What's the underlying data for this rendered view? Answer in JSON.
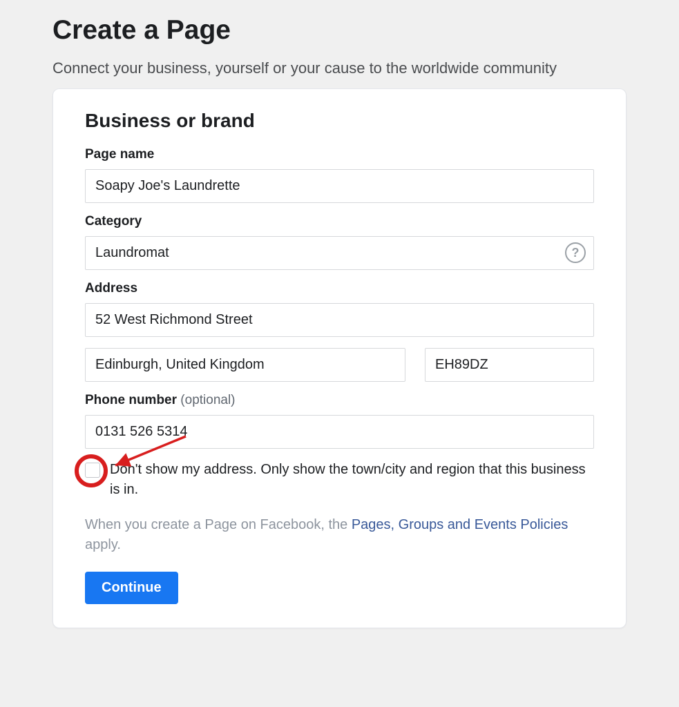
{
  "header": {
    "title": "Create a Page",
    "subtitle": "Connect your business, yourself or your cause to the worldwide community"
  },
  "form": {
    "section_title": "Business or brand",
    "page_name": {
      "label": "Page name",
      "value": "Soapy Joe's Laundrette"
    },
    "category": {
      "label": "Category",
      "value": "Laundromat"
    },
    "address": {
      "label": "Address",
      "street": "52 West Richmond Street",
      "city": "Edinburgh, United Kingdom",
      "postcode": "EH89DZ"
    },
    "phone": {
      "label": "Phone number",
      "optional": "(optional)",
      "value": "0131 526 5314"
    },
    "hide_address": {
      "label": "Don't show my address. Only show the town/city and region that this business is in."
    },
    "policy": {
      "prefix": "When you create a Page on Facebook, the ",
      "link": "Pages, Groups and Events Policies",
      "suffix": " apply."
    },
    "continue_label": "Continue"
  }
}
